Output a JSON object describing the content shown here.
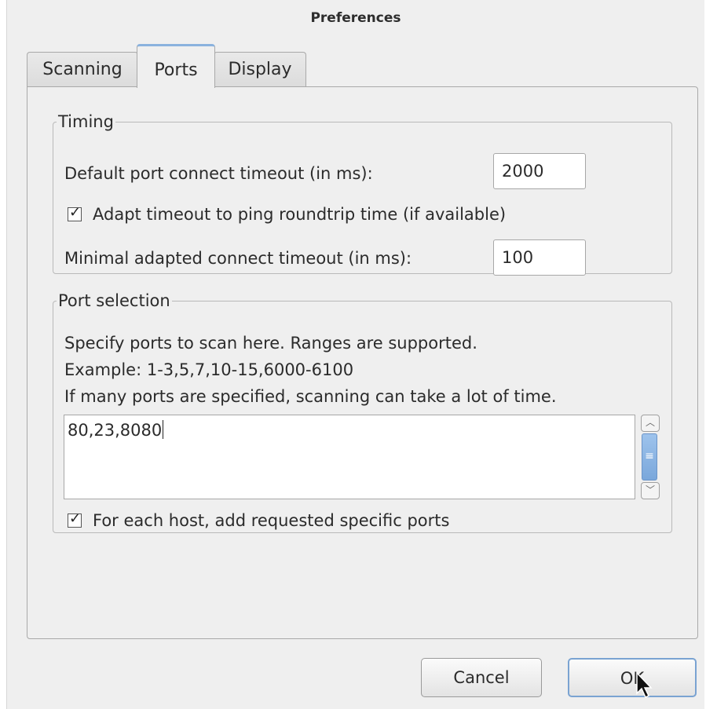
{
  "window": {
    "title": "Preferences"
  },
  "tabs": [
    {
      "label": "Scanning",
      "active": false
    },
    {
      "label": "Ports",
      "active": true
    },
    {
      "label": "Display",
      "active": false
    }
  ],
  "timing": {
    "legend": "Timing",
    "default_timeout_label": "Default port connect timeout (in ms):",
    "default_timeout_value": "2000",
    "adapt_checkbox_label": "Adapt timeout to ping roundtrip time (if available)",
    "adapt_checked": true,
    "minimal_timeout_label": "Minimal adapted connect timeout (in ms):",
    "minimal_timeout_value": "100"
  },
  "port_selection": {
    "legend": "Port selection",
    "help_line1": "Specify ports to scan here. Ranges are supported.",
    "help_line2": "Example: 1-3,5,7,10-15,6000-6100",
    "help_line3": "If many ports are specified, scanning can take a lot of time.",
    "ports_value": "80,23,8080",
    "add_requested_label": "For each host, add requested specific ports",
    "add_requested_checked": true
  },
  "buttons": {
    "cancel": "Cancel",
    "ok": "OK"
  },
  "icons": {
    "checkbox": "checkmark-icon",
    "scroll_up": "chevron-up-icon",
    "scroll_down": "chevron-down-icon",
    "cursor": "mouse-pointer-icon"
  },
  "colors": {
    "accent": "#8ab2de",
    "scroll_thumb": "#7aa7db"
  }
}
